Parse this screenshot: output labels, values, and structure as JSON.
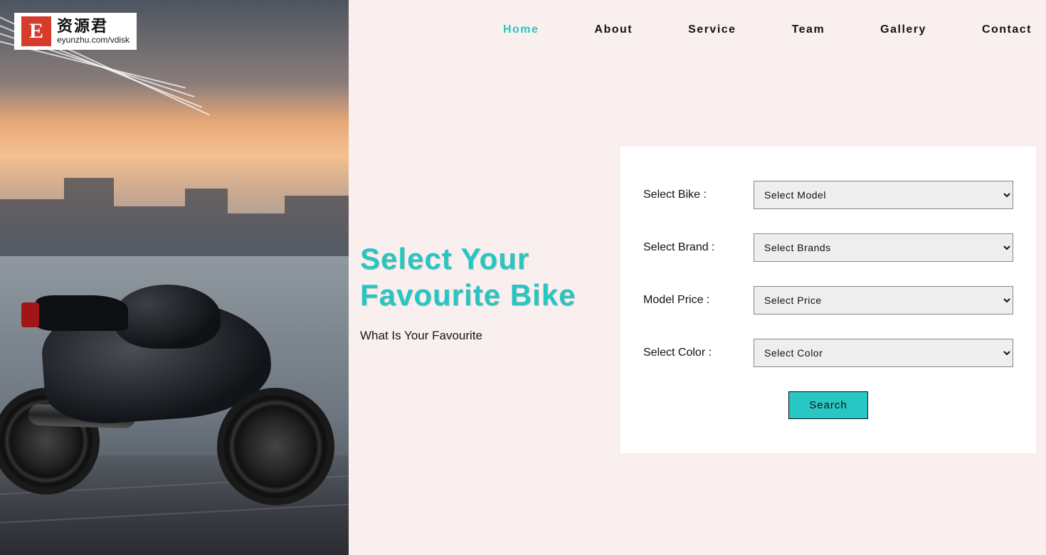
{
  "logo": {
    "mark": "E",
    "main": "资源君",
    "sub": "eyunzhu.com/vdisk"
  },
  "nav": {
    "items": [
      {
        "label": "Home",
        "active": true
      },
      {
        "label": "About",
        "active": false
      },
      {
        "label": "Service",
        "active": false
      },
      {
        "label": "Team",
        "active": false
      },
      {
        "label": "Gallery",
        "active": false
      },
      {
        "label": "Contact",
        "active": false
      }
    ]
  },
  "hero": {
    "title": "Select Your Favourite Bike",
    "subtitle": "What Is Your Favourite"
  },
  "form": {
    "rows": [
      {
        "label": "Select Bike :",
        "selected": "Select Model"
      },
      {
        "label": "Select Brand :",
        "selected": "Select Brands"
      },
      {
        "label": "Model Price :",
        "selected": "Select Price"
      },
      {
        "label": "Select Color :",
        "selected": "Select Color"
      }
    ],
    "search_label": "Search"
  },
  "colors": {
    "accent": "#28c6c2",
    "page_bg": "#faefef",
    "logo_red": "#d63b2c"
  }
}
